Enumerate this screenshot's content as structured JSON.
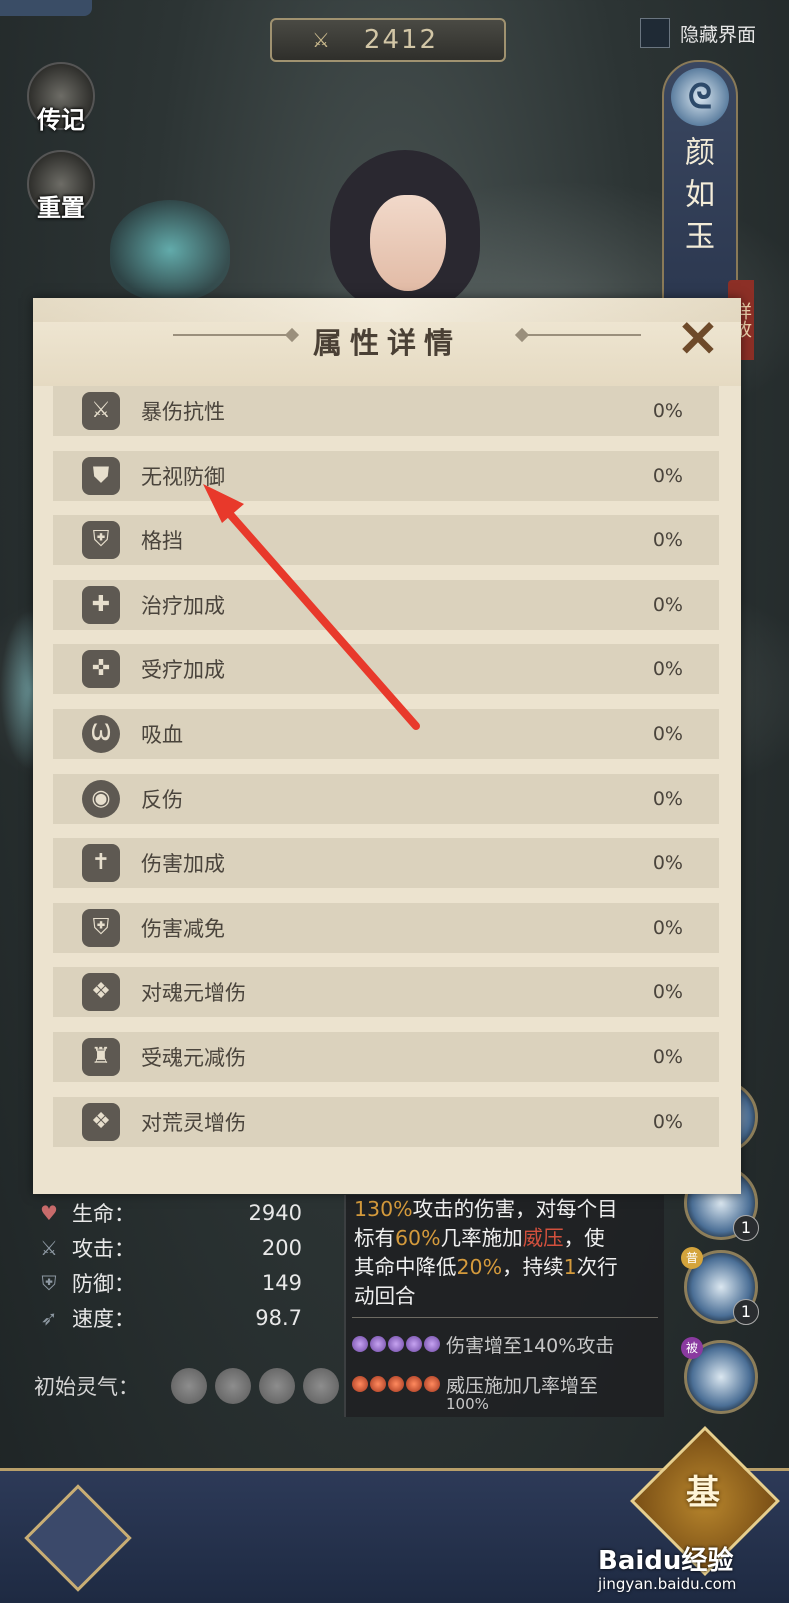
{
  "top": {
    "power_value": "2412",
    "hide_ui_label": "隐藏界面"
  },
  "side_buttons": {
    "biography": "传记",
    "reset": "重置"
  },
  "character": {
    "name": "颜如玉",
    "detail_tab": "详故"
  },
  "modal": {
    "title": "属性详情",
    "rows": [
      {
        "label": "暴伤抗性",
        "value": "0%",
        "icon": "crit-resist-icon"
      },
      {
        "label": "无视防御",
        "value": "0%",
        "icon": "ignore-defense-icon"
      },
      {
        "label": "格挡",
        "value": "0%",
        "icon": "block-icon"
      },
      {
        "label": "治疗加成",
        "value": "0%",
        "icon": "heal-bonus-icon"
      },
      {
        "label": "受疗加成",
        "value": "0%",
        "icon": "received-heal-icon"
      },
      {
        "label": "吸血",
        "value": "0%",
        "icon": "lifesteal-icon"
      },
      {
        "label": "反伤",
        "value": "0%",
        "icon": "reflect-icon"
      },
      {
        "label": "伤害加成",
        "value": "0%",
        "icon": "damage-bonus-icon"
      },
      {
        "label": "伤害减免",
        "value": "0%",
        "icon": "damage-reduction-icon"
      },
      {
        "label": "对魂元增伤",
        "value": "0%",
        "icon": "soul-damage-icon"
      },
      {
        "label": "受魂元减伤",
        "value": "0%",
        "icon": "soul-defense-icon"
      },
      {
        "label": "对荒灵增伤",
        "value": "0%",
        "icon": "wild-spirit-damage-icon"
      }
    ]
  },
  "stats": {
    "hp_label": "生命：",
    "hp_value": "2940",
    "atk_label": "攻击：",
    "atk_value": "200",
    "def_label": "防御：",
    "def_value": "149",
    "spd_label": "速度：",
    "spd_value": "98.7",
    "aura_label": "初始灵气："
  },
  "skill": {
    "line1_a": "130%",
    "line1_b": "攻击的伤害，对每个目",
    "line2_a": "标有",
    "line2_b": "60%",
    "line2_c": "几率施加",
    "line2_d": "威压",
    "line2_e": "，使",
    "line3_a": "其命中降低",
    "line3_b": "20%",
    "line3_c": "，持续",
    "line3_d": "1",
    "line3_e": "次行",
    "line4": "动回合",
    "upgrade1": "伤害增至140%攻击",
    "upgrade2": "威压施加几率增至",
    "upgrade2_cont": "100%"
  },
  "orbs": {
    "orb1_level": "1",
    "orb2_level": "1",
    "orb2_tag": "普",
    "orb3_tag": "被"
  },
  "bottom": {
    "basic_label": "基",
    "watermark": "Baidu经验",
    "watermark_sub": "jingyan.baidu.com"
  },
  "colors": {
    "modal_bg": "#ece3cf",
    "row_bg": "#dbd2bd",
    "arrow": "#e8392b",
    "highlight_orange": "#d49a3c",
    "highlight_red": "#d2503d"
  }
}
